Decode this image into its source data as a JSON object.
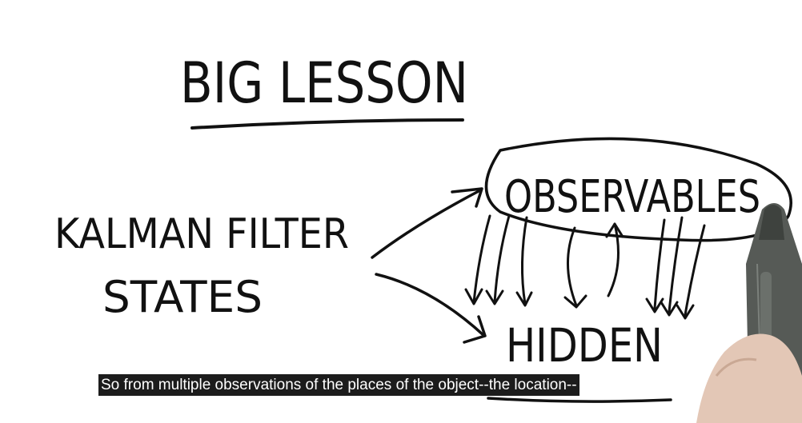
{
  "diagram": {
    "title": "BIG LESSON",
    "left_labels": [
      "KALMAN FILTER",
      "STATES"
    ],
    "top_node": "OBSERVABLES",
    "bottom_node": "HIDDEN"
  },
  "subtitle": "So from multiple observations of the places of the object--the location--"
}
